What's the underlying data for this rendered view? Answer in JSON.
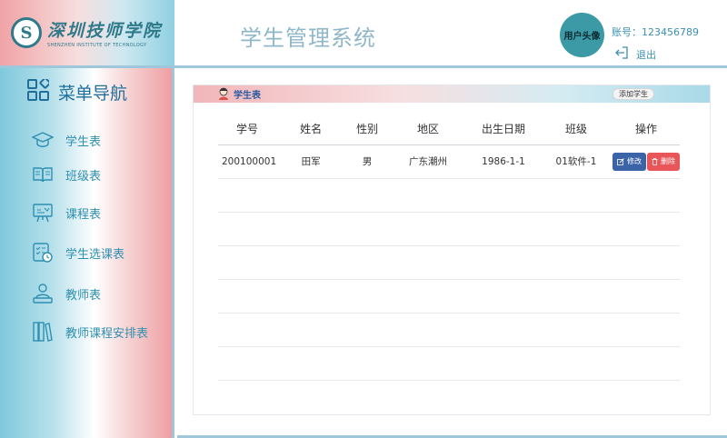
{
  "logo": {
    "name_cn": "深圳技师学院",
    "name_en": "SHENZHEN INSTITUTE OF TECHNOLOGY",
    "badge": "S"
  },
  "header": {
    "app_title": "学生管理系统",
    "avatar_label": "用户头像",
    "account_label": "账号：",
    "account_value": "123456789",
    "logout_label": "退出"
  },
  "sidebar": {
    "title": "菜单导航",
    "items": [
      {
        "label": "学生表",
        "icon": "graduation-cap-icon"
      },
      {
        "label": "班级表",
        "icon": "open-book-icon"
      },
      {
        "label": "课程表",
        "icon": "presentation-board-icon"
      },
      {
        "label": "学生选课表",
        "icon": "checklist-clock-icon"
      },
      {
        "label": "教师表",
        "icon": "teacher-icon"
      },
      {
        "label": "教师课程安排表",
        "icon": "bookshelf-icon"
      }
    ]
  },
  "panel": {
    "title": "学生表",
    "add_button": "添加学生",
    "columns": [
      "学号",
      "姓名",
      "性别",
      "地区",
      "出生日期",
      "班级",
      "操作"
    ],
    "rows": [
      {
        "id": "200100001",
        "name": "田军",
        "gender": "男",
        "region": "广东潮州",
        "birth": "1986-1-1",
        "class": "01软件-1"
      }
    ],
    "edit_label": "修改",
    "delete_label": "删除"
  },
  "colors": {
    "accent_blue": "#1f6f9a",
    "avatar_teal": "#3c9aa6",
    "edit_button": "#3b63a8",
    "delete_button": "#e8565a"
  }
}
